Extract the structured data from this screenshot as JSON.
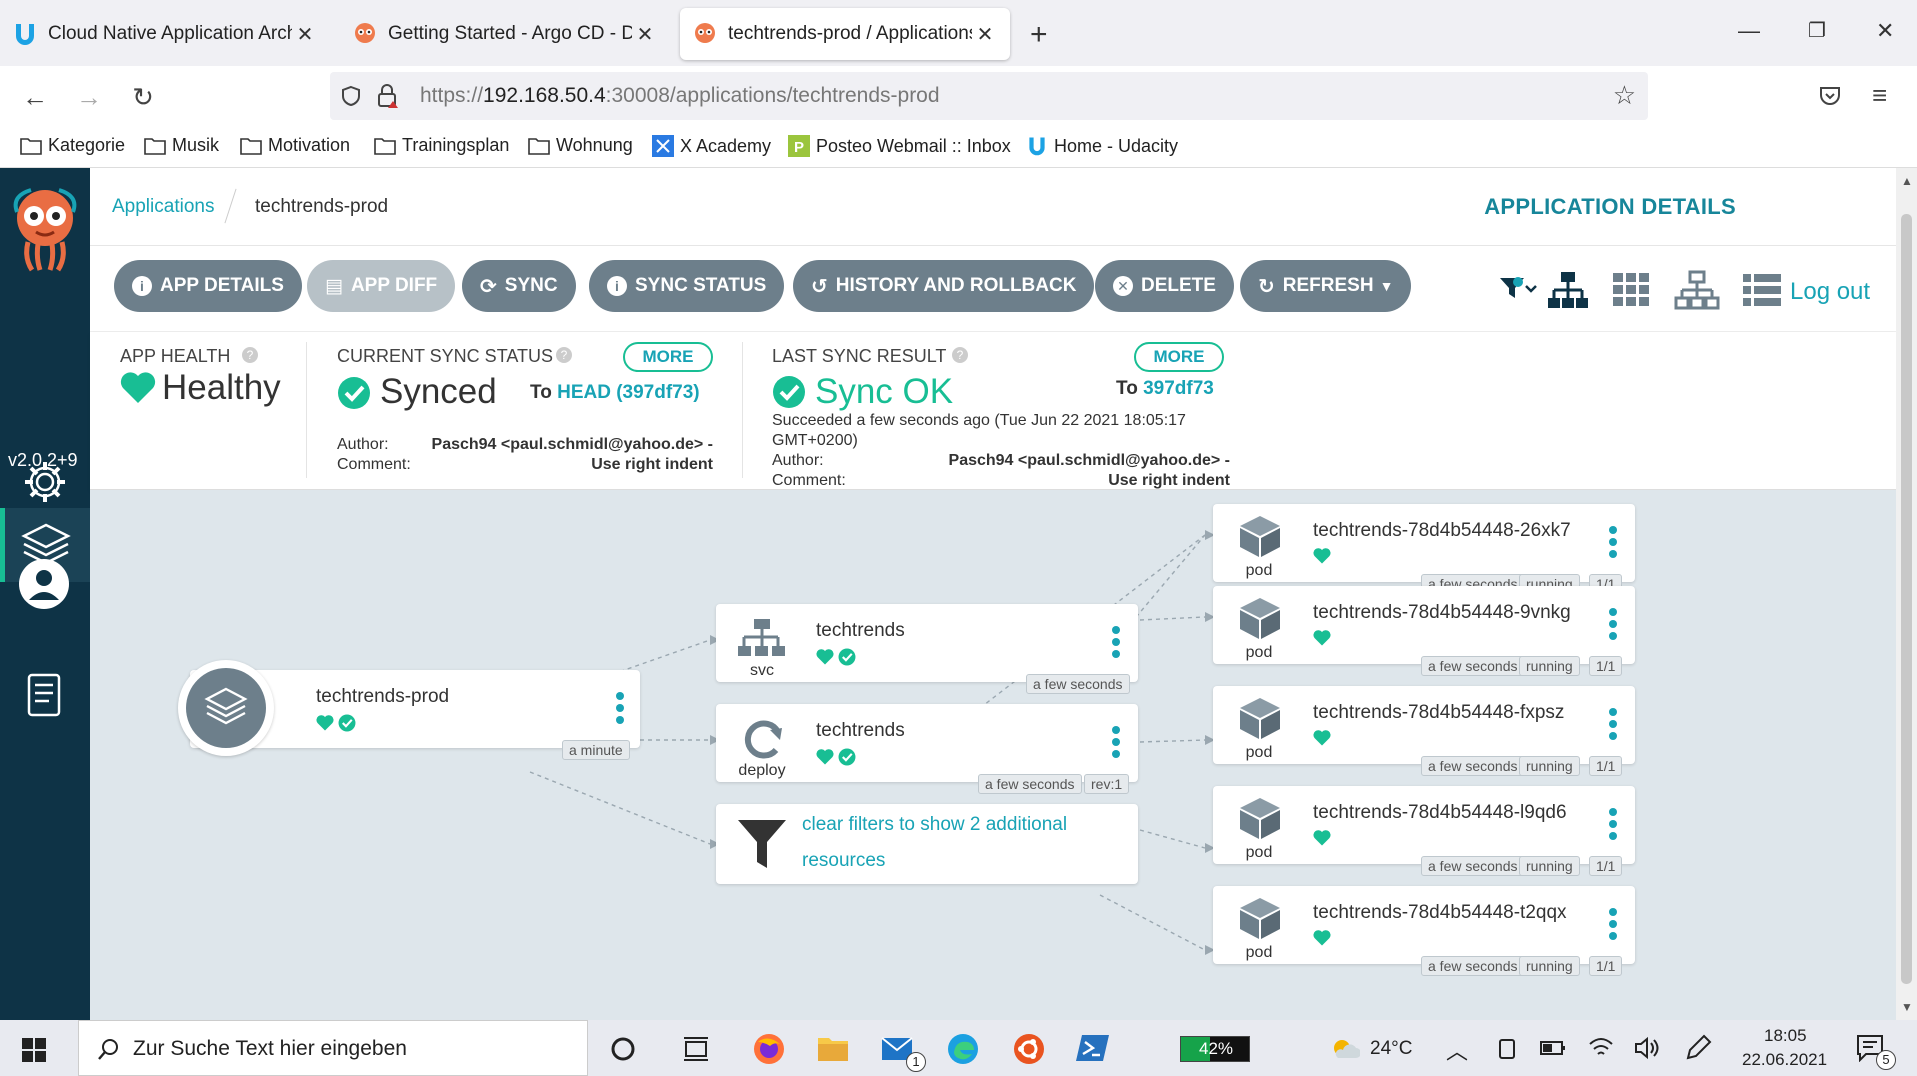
{
  "browser": {
    "tabs": [
      {
        "title": "Cloud Native Application Archit",
        "active": false
      },
      {
        "title": "Getting Started - Argo CD - Dec",
        "active": false
      },
      {
        "title": "techtrends-prod / Applications",
        "active": true
      }
    ],
    "url_prefix": "https://",
    "url_host": "192.168.50.4",
    "url_path": ":30008/applications/techtrends-prod",
    "bookmarks": [
      "Kategorie",
      "Musik",
      "Motivation",
      "Trainingsplan",
      "Wohnung",
      "X Academy",
      "Posteo Webmail :: Inbox",
      "Home - Udacity"
    ]
  },
  "argo": {
    "version": "v2.0.2+9",
    "breadcrumb_root": "Applications",
    "breadcrumb_current": "techtrends-prod",
    "page_title": "APPLICATION DETAILS",
    "toolbar": {
      "app_details": "APP DETAILS",
      "app_diff": "APP DIFF",
      "sync": "SYNC",
      "sync_status": "SYNC STATUS",
      "history": "HISTORY AND ROLLBACK",
      "delete": "DELETE",
      "refresh": "REFRESH",
      "logout": "Log out"
    },
    "health": {
      "title": "APP HEALTH",
      "value": "Healthy"
    },
    "sync_status": {
      "title": "CURRENT SYNC STATUS",
      "more": "MORE",
      "value": "Synced",
      "to_label": "To",
      "to_ref": "HEAD (397df73)",
      "author_label": "Author:",
      "author": "Pasch94 <paul.schmidl@yahoo.de> -",
      "comment_label": "Comment:",
      "comment": "Use right indent"
    },
    "last_sync": {
      "title": "LAST SYNC RESULT",
      "more": "MORE",
      "value": "Sync OK",
      "to_label": "To",
      "to_ref": "397df73",
      "succeeded": "Succeeded a few seconds ago (Tue Jun 22 2021 18:05:17",
      "succeeded2": "GMT+0200)",
      "author_label": "Author:",
      "author": "Pasch94 <paul.schmidl@yahoo.de> -",
      "comment_label": "Comment:",
      "comment": "Use right indent"
    },
    "graph": {
      "app": {
        "name": "techtrends-prod",
        "age": "a minute"
      },
      "svc": {
        "name": "techtrends",
        "kind": "svc",
        "age": "a few seconds"
      },
      "deploy": {
        "name": "techtrends",
        "kind": "deploy",
        "age": "a few seconds",
        "rev": "rev:1"
      },
      "filter": {
        "line1": "clear filters to show 2 additional",
        "line2": "resources"
      },
      "pods": [
        {
          "name": "techtrends-78d4b54448-26xk7",
          "kind": "pod",
          "age": "a few seconds",
          "state": "running",
          "ready": "1/1"
        },
        {
          "name": "techtrends-78d4b54448-9vnkg",
          "kind": "pod",
          "age": "a few seconds",
          "state": "running",
          "ready": "1/1"
        },
        {
          "name": "techtrends-78d4b54448-fxpsz",
          "kind": "pod",
          "age": "a few seconds",
          "state": "running",
          "ready": "1/1"
        },
        {
          "name": "techtrends-78d4b54448-l9qd6",
          "kind": "pod",
          "age": "a few seconds",
          "state": "running",
          "ready": "1/1"
        },
        {
          "name": "techtrends-78d4b54448-t2qqx",
          "kind": "pod",
          "age": "a few seconds",
          "state": "running",
          "ready": "1/1"
        }
      ]
    }
  },
  "taskbar": {
    "search_placeholder": "Zur Suche Text hier eingeben",
    "battery": "42%",
    "temperature": "24°C",
    "time": "18:05",
    "date": "22.06.2021",
    "notifications": "5",
    "mail_badge": "1"
  },
  "colors": {
    "accent": "#18a3b5",
    "healthy": "#18be94",
    "sidebar": "#0e3346",
    "graph_bg": "#dee6eb"
  }
}
